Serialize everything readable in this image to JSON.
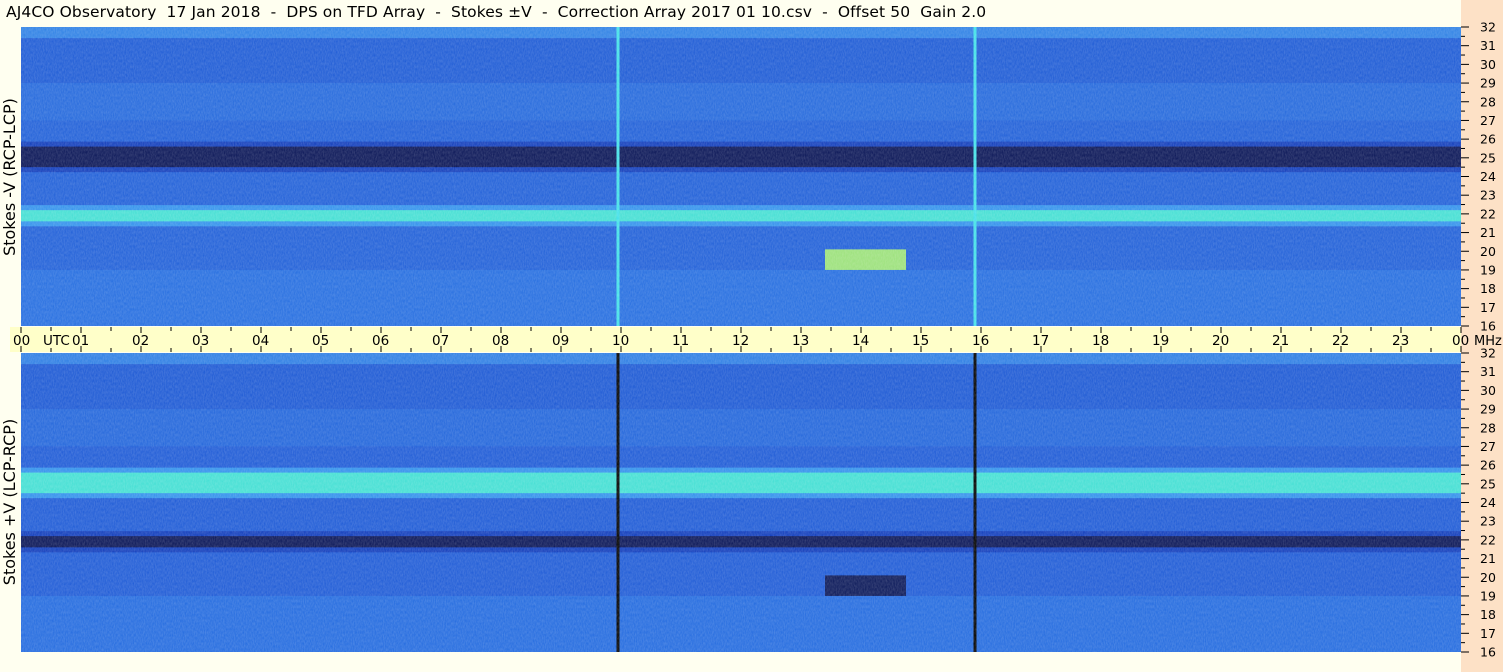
{
  "title": "AJ4CO Observatory  17 Jan 2018  -  DPS on TFD Array  -  Stokes ±V  -  Correction Array 2017 01 10.csv  -  Offset 50  Gain 2.0",
  "colors": {
    "background": "#fffff0",
    "time_axis_bg": "#ffffc9",
    "freq_axis_bg": "#fde1c6",
    "colormap": [
      "#08104a",
      "#0a2fb0",
      "#1f6fe6",
      "#3aa8f5",
      "#45e8d0",
      "#f0ff40",
      "#ff5020"
    ]
  },
  "chart_data": [
    {
      "type": "heatmap",
      "name": "Stokes -V (RCP-LCP)",
      "ylabel": "Stokes -V (RCP-LCP)",
      "x_range_utc_hours": [
        0,
        24
      ],
      "y_range_mhz": [
        16,
        32
      ],
      "y_ticks": [
        "32",
        "31",
        "30",
        "29",
        "28",
        "27",
        "26",
        "25",
        "24",
        "23",
        "22",
        "21",
        "20",
        "19",
        "18",
        "17",
        "16"
      ],
      "features": [
        {
          "desc": "dark band",
          "freq_mhz": [
            24.5,
            25.6
          ],
          "level": "low"
        },
        {
          "desc": "bright band",
          "freq_mhz": [
            21.6,
            22.2
          ],
          "level": "high"
        },
        {
          "desc": "vertical line",
          "time_utc": 9.95,
          "color": "cyan"
        },
        {
          "desc": "vertical line",
          "time_utc": 15.9,
          "color": "cyan"
        },
        {
          "desc": "bright patch",
          "time_utc": [
            13.4,
            14.75
          ],
          "freq_mhz": [
            19,
            20.1
          ]
        }
      ]
    },
    {
      "type": "heatmap",
      "name": "Stokes +V (LCP-RCP)",
      "ylabel": "Stokes +V (LCP-RCP)",
      "x_range_utc_hours": [
        0,
        24
      ],
      "y_range_mhz": [
        16,
        32
      ],
      "y_ticks": [
        "32",
        "31",
        "30",
        "29",
        "28",
        "27",
        "26",
        "25",
        "24",
        "23",
        "22",
        "21",
        "20",
        "19",
        "18",
        "17",
        "16"
      ],
      "features": [
        {
          "desc": "bright band",
          "freq_mhz": [
            24.5,
            25.6
          ],
          "level": "high"
        },
        {
          "desc": "dark band",
          "freq_mhz": [
            21.6,
            22.2
          ],
          "level": "low"
        },
        {
          "desc": "vertical line",
          "time_utc": 9.95,
          "color": "black"
        },
        {
          "desc": "vertical line",
          "time_utc": 15.9,
          "color": "black"
        },
        {
          "desc": "dark patch",
          "time_utc": [
            13.4,
            14.75
          ],
          "freq_mhz": [
            19,
            20.1
          ]
        }
      ]
    }
  ],
  "time_axis": {
    "labels": [
      "00",
      "01",
      "02",
      "03",
      "04",
      "05",
      "06",
      "07",
      "08",
      "09",
      "10",
      "11",
      "12",
      "13",
      "14",
      "15",
      "16",
      "17",
      "18",
      "19",
      "20",
      "21",
      "22",
      "23",
      "00"
    ],
    "utc_label": "UTC",
    "unit": "MHz"
  }
}
